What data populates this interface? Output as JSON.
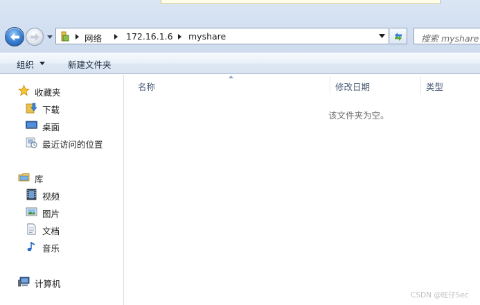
{
  "navigation": {
    "back_icon": "back-arrow-icon",
    "forward_icon": "forward-arrow-icon",
    "history_icon": "chevron-down-icon"
  },
  "address_bar": {
    "crumbs": [
      "网络",
      "172.16.1.6",
      "myshare"
    ],
    "folder_icon": "folder-icon",
    "dropdown_icon": "chevron-down-icon",
    "refresh_icon": "refresh-icon"
  },
  "search": {
    "placeholder": "搜索 myshare"
  },
  "toolbar": {
    "organize_label": "组织",
    "new_folder_label": "新建文件夹"
  },
  "sidebar": {
    "favorites": {
      "label": "收藏夹",
      "icon": "star-icon",
      "items": [
        {
          "label": "下载",
          "icon": "downloads-folder-icon"
        },
        {
          "label": "桌面",
          "icon": "desktop-icon"
        },
        {
          "label": "最近访问的位置",
          "icon": "recent-places-icon"
        }
      ]
    },
    "libraries": {
      "label": "库",
      "icon": "library-icon",
      "items": [
        {
          "label": "视频",
          "icon": "video-icon"
        },
        {
          "label": "图片",
          "icon": "pictures-icon"
        },
        {
          "label": "文档",
          "icon": "documents-icon"
        },
        {
          "label": "音乐",
          "icon": "music-icon"
        }
      ]
    },
    "computer": {
      "label": "计算机",
      "icon": "computer-icon"
    }
  },
  "file_list": {
    "columns": [
      "名称",
      "修改日期",
      "类型"
    ],
    "empty_message": "该文件夹为空。"
  },
  "watermark": "CSDN @旺仔Sec",
  "colors": {
    "chrome_bg": "#d3e0f1",
    "accent_blue": "#3f86d6",
    "header_text": "#4b5d78"
  }
}
